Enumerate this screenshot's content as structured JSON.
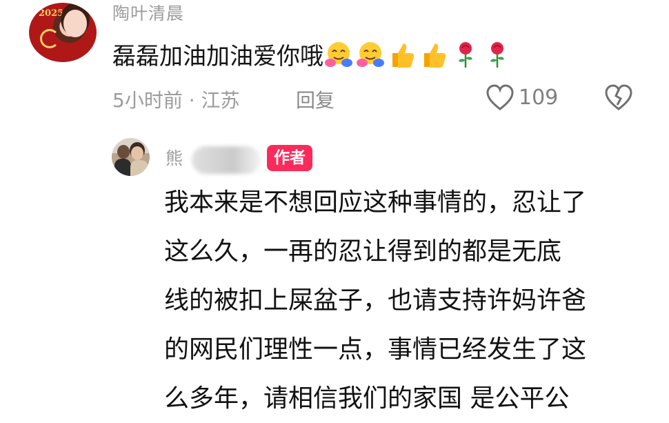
{
  "comment": {
    "username": "陶叶清晨",
    "avatar_text": "2025",
    "text": "磊磊加油加油爱你哦",
    "emojis": [
      "hug-emoji",
      "hug-emoji",
      "thumbs-up-emoji",
      "thumbs-up-emoji",
      "rose-emoji",
      "rose-emoji"
    ],
    "time_location": "5小时前 · 江苏",
    "reply_label": "回复",
    "like_count": "109"
  },
  "reply": {
    "username_visible": "熊",
    "author_badge": "作者",
    "lines": [
      "我本来是不想回应这种事情的，忍让了",
      "这么久，一再的忍让得到的都是无底",
      "线的被扣上屎盆子，也请支持许妈许爸",
      "的网民们理性一点，事情已经发生了这",
      "么多年，请相信我们的家国 是公平公"
    ]
  },
  "colors": {
    "badge": "#fb2a5a",
    "meta_text": "#9b9b9b",
    "body_text": "#111111"
  }
}
